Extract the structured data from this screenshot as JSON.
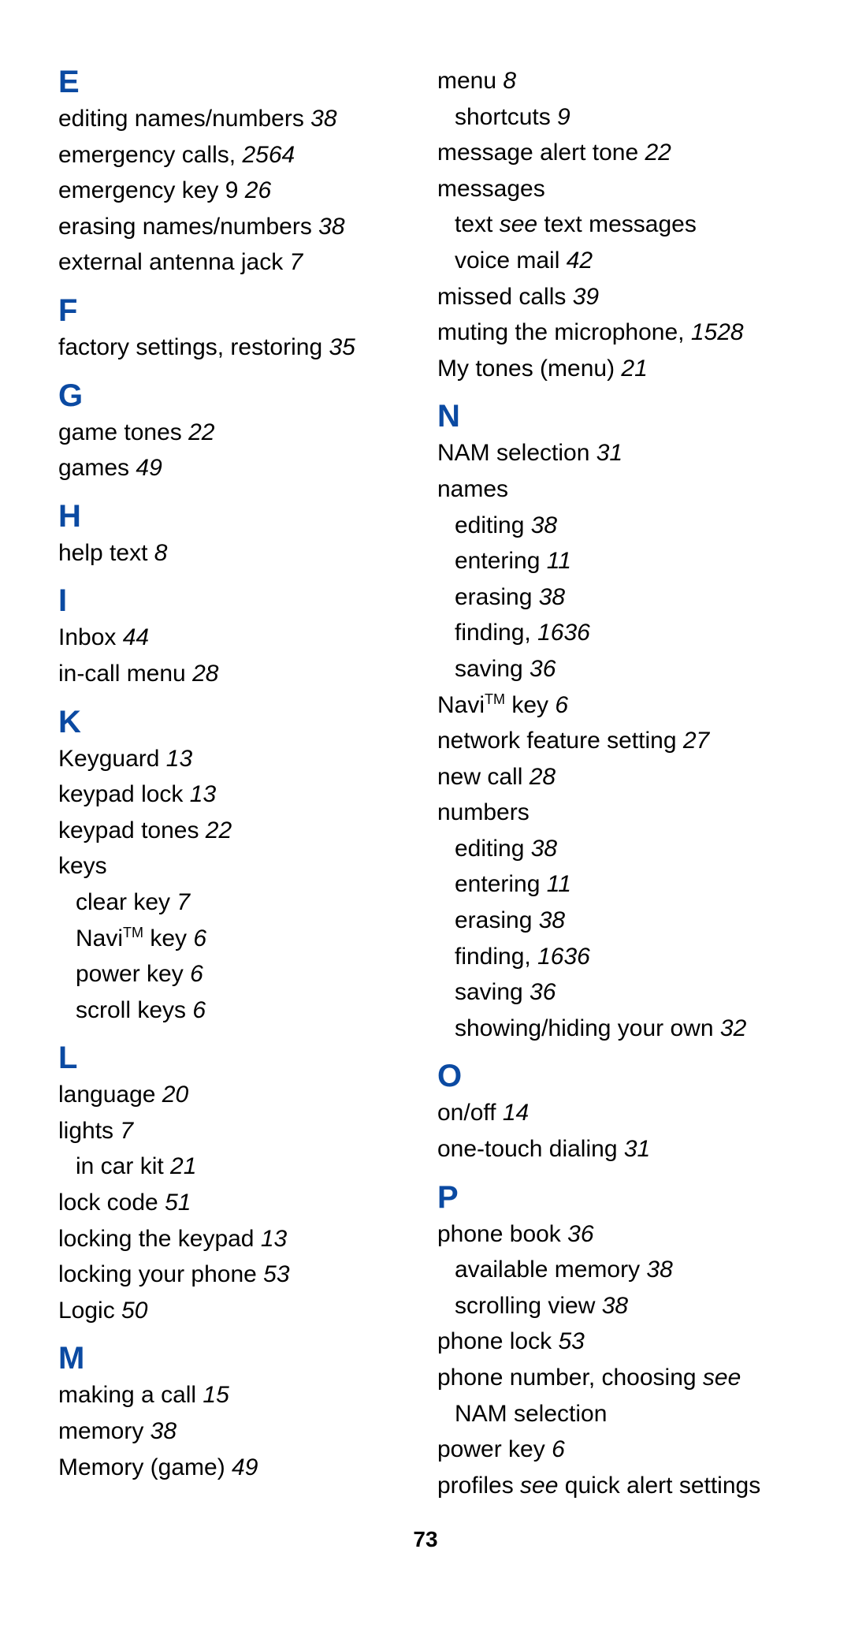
{
  "pageNumber": "73",
  "left": [
    {
      "type": "letter",
      "text": "E"
    },
    {
      "type": "entry",
      "text": "editing names/numbers",
      "pages": " 38"
    },
    {
      "type": "entry",
      "text": "emergency calls",
      "pages": " 25",
      "after": ", ",
      "pages2": "64"
    },
    {
      "type": "entry",
      "text": "emergency key 9",
      "pages": " 26"
    },
    {
      "type": "entry",
      "text": "erasing names/numbers",
      "pages": " 38"
    },
    {
      "type": "entry",
      "text": "external antenna jack",
      "pages": " 7"
    },
    {
      "type": "letter",
      "text": "F"
    },
    {
      "type": "entry",
      "text": "factory settings, restoring",
      "pages": " 35"
    },
    {
      "type": "letter",
      "text": "G"
    },
    {
      "type": "entry",
      "text": "game tones",
      "pages": " 22"
    },
    {
      "type": "entry",
      "text": "games",
      "pages": " 49"
    },
    {
      "type": "letter",
      "text": "H"
    },
    {
      "type": "entry",
      "text": "help text",
      "pages": " 8"
    },
    {
      "type": "letter",
      "text": "I"
    },
    {
      "type": "entry",
      "text": "Inbox",
      "pages": " 44"
    },
    {
      "type": "entry",
      "text": "in-call menu",
      "pages": " 28"
    },
    {
      "type": "letter",
      "text": "K"
    },
    {
      "type": "entry",
      "text": "Keyguard",
      "pages": " 13"
    },
    {
      "type": "entry",
      "text": "keypad lock",
      "pages": " 13"
    },
    {
      "type": "entry",
      "text": "keypad tones",
      "pages": " 22"
    },
    {
      "type": "entry",
      "text": "keys"
    },
    {
      "type": "sub",
      "text": "clear key",
      "pages": " 7"
    },
    {
      "type": "sub",
      "navi": true,
      "pages": " 6"
    },
    {
      "type": "sub",
      "text": "power key",
      "pages": " 6"
    },
    {
      "type": "sub",
      "text": "scroll keys",
      "pages": " 6"
    },
    {
      "type": "letter",
      "text": "L"
    },
    {
      "type": "entry",
      "text": "language",
      "pages": " 20"
    },
    {
      "type": "entry",
      "text": "lights",
      "pages": " 7"
    },
    {
      "type": "sub",
      "text": "in car kit",
      "pages": " 21"
    },
    {
      "type": "entry",
      "text": "lock code",
      "pages": " 51"
    },
    {
      "type": "entry",
      "text": "locking the keypad",
      "pages": " 13"
    },
    {
      "type": "entry",
      "text": "locking your phone",
      "pages": " 53"
    },
    {
      "type": "entry",
      "text": "Logic",
      "pages": " 50"
    },
    {
      "type": "letter",
      "text": "M"
    },
    {
      "type": "entry",
      "text": "making a call",
      "pages": " 15"
    },
    {
      "type": "entry",
      "text": "memory",
      "pages": " 38"
    },
    {
      "type": "entry",
      "text": "Memory (game)",
      "pages": " 49"
    }
  ],
  "right": [
    {
      "type": "entry",
      "text": "menu",
      "pages": " 8"
    },
    {
      "type": "sub",
      "text": "shortcuts",
      "pages": " 9"
    },
    {
      "type": "entry",
      "text": "message alert tone",
      "pages": " 22"
    },
    {
      "type": "entry",
      "text": "messages"
    },
    {
      "type": "sub",
      "text": "text ",
      "see": "see",
      "after": " text messages"
    },
    {
      "type": "sub",
      "text": "voice mail",
      "pages": " 42"
    },
    {
      "type": "entry",
      "text": "missed calls",
      "pages": " 39"
    },
    {
      "type": "entry",
      "text": "muting the microphone",
      "pages": " 15",
      "after": ", ",
      "pages2": "28"
    },
    {
      "type": "entry",
      "text": "My tones (menu)",
      "pages": " 21"
    },
    {
      "type": "letter",
      "text": "N"
    },
    {
      "type": "entry",
      "text": "NAM selection",
      "pages": " 31"
    },
    {
      "type": "entry",
      "text": "names"
    },
    {
      "type": "sub",
      "text": "editing",
      "pages": " 38"
    },
    {
      "type": "sub",
      "text": "entering",
      "pages": " 11"
    },
    {
      "type": "sub",
      "text": "erasing",
      "pages": " 38"
    },
    {
      "type": "sub",
      "text": "finding",
      "pages": " 16",
      "after": ", ",
      "pages2": "36"
    },
    {
      "type": "sub",
      "text": "saving",
      "pages": " 36"
    },
    {
      "type": "entry",
      "navi": true,
      "pages": " 6"
    },
    {
      "type": "entry",
      "text": "network feature setting",
      "pages": " 27"
    },
    {
      "type": "entry",
      "text": "new call",
      "pages": " 28"
    },
    {
      "type": "entry",
      "text": "numbers"
    },
    {
      "type": "sub",
      "text": "editing",
      "pages": " 38"
    },
    {
      "type": "sub",
      "text": "entering",
      "pages": " 11"
    },
    {
      "type": "sub",
      "text": "erasing",
      "pages": " 38"
    },
    {
      "type": "sub",
      "text": "finding",
      "pages": " 16",
      "after": ", ",
      "pages2": "36"
    },
    {
      "type": "sub",
      "text": "saving",
      "pages": " 36"
    },
    {
      "type": "sub",
      "text": "showing/hiding your own",
      "pages": " 32"
    },
    {
      "type": "letter",
      "text": "O"
    },
    {
      "type": "entry",
      "text": "on/off",
      "pages": " 14"
    },
    {
      "type": "entry",
      "text": "one-touch dialing",
      "pages": " 31"
    },
    {
      "type": "letter",
      "text": "P"
    },
    {
      "type": "entry",
      "text": "phone book",
      "pages": " 36"
    },
    {
      "type": "sub",
      "text": "available memory",
      "pages": " 38"
    },
    {
      "type": "sub",
      "text": "scrolling view",
      "pages": " 38"
    },
    {
      "type": "entry",
      "text": "phone lock",
      "pages": " 53"
    },
    {
      "type": "entry",
      "text": "phone number, choosing ",
      "see": "see",
      "wrap": "NAM selection"
    },
    {
      "type": "entry",
      "text": "power key",
      "pages": " 6"
    },
    {
      "type": "entry",
      "text": "profiles ",
      "see": "see",
      "after": " quick alert settings"
    }
  ]
}
